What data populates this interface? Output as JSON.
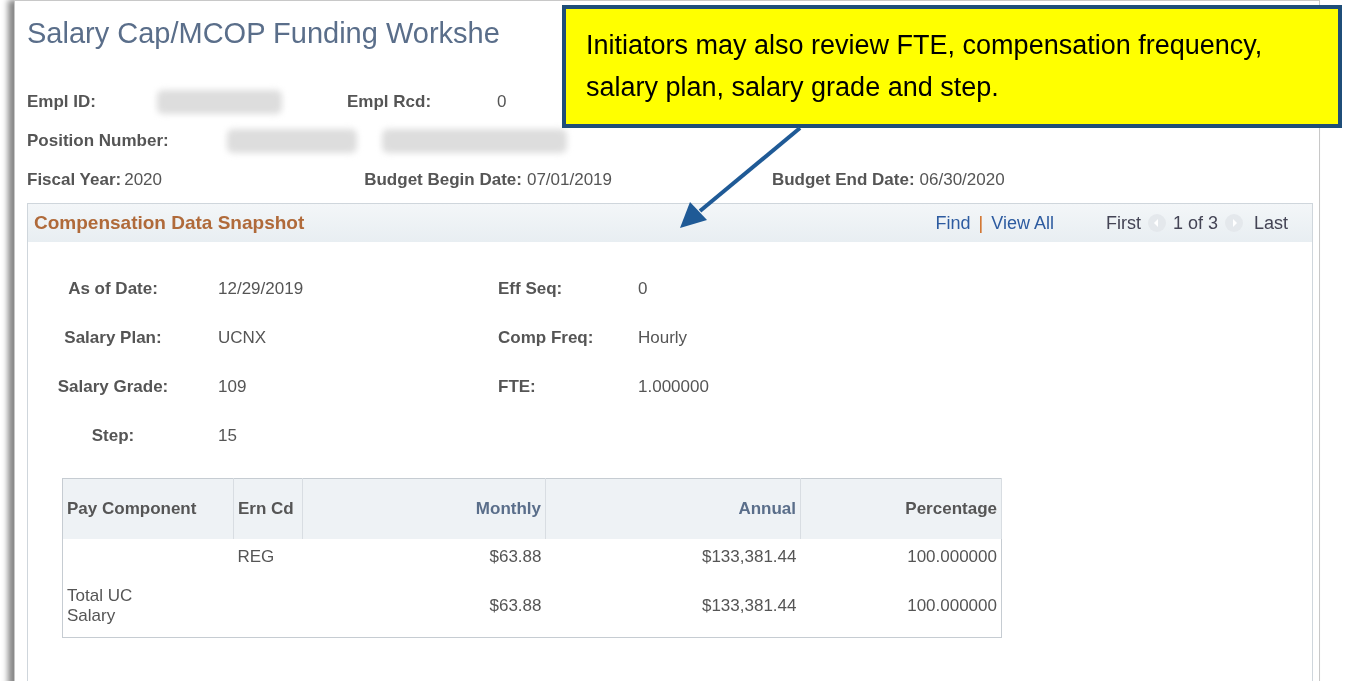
{
  "title": "Salary Cap/MCOP Funding Workshe",
  "header_rows": [
    [
      {
        "kind": "label",
        "text": "Empl ID:"
      },
      {
        "kind": "redacted"
      },
      {
        "kind": "label",
        "text": "Empl Rcd:"
      },
      {
        "kind": "value",
        "text": "0"
      }
    ],
    [
      {
        "kind": "label",
        "text": "Position Number:"
      },
      {
        "kind": "redacted"
      },
      {
        "kind": "redacted"
      }
    ],
    [
      {
        "kind": "label",
        "text": "Fiscal Year:"
      },
      {
        "kind": "value",
        "text": "2020"
      },
      {
        "kind": "label",
        "text": "Budget Begin Date:"
      },
      {
        "kind": "value",
        "text": "07/01/2019"
      },
      {
        "kind": "label",
        "text": "Budget End Date:"
      },
      {
        "kind": "value",
        "text": "06/30/2020"
      }
    ]
  ],
  "snapshot": {
    "title": "Compensation Data Snapshot",
    "nav": {
      "find": "Find",
      "separator": "|",
      "view_all": "View All",
      "first": "First",
      "counter": "1 of 3",
      "last": "Last"
    },
    "fields": [
      {
        "label": "As of Date:",
        "value": "12/29/2019",
        "label2": "Eff Seq:",
        "value2": "0"
      },
      {
        "label": "Salary Plan:",
        "value": "UCNX",
        "label2": "Comp Freq:",
        "value2": "Hourly"
      },
      {
        "label": "Salary Grade:",
        "value": "109",
        "label2": "FTE:",
        "value2": "1.000000"
      },
      {
        "label": "Step:",
        "value": "15"
      }
    ],
    "table": {
      "columns": [
        "Pay Component",
        "Ern Cd",
        "Monthly",
        "Annual",
        "Percentage"
      ],
      "rows": [
        [
          null,
          "REG",
          "$63.88",
          "$133,381.44",
          "100.000000"
        ],
        [
          "Total UC Salary",
          null,
          "$63.88",
          "$133,381.44",
          "100.000000"
        ]
      ]
    }
  },
  "callout": {
    "text": "Initiators may also review FTE, compensation frequency, salary plan, salary grade and step."
  }
}
